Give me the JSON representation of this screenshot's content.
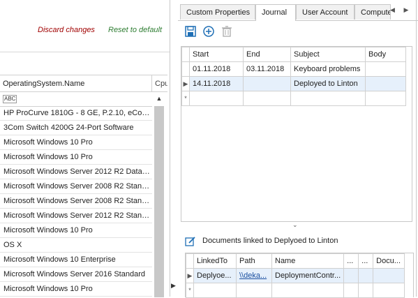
{
  "left": {
    "discard_label": "Discard changes",
    "reset_label": "Reset to default",
    "grid": {
      "col_os": "OperatingSystem.Name",
      "col_cpu": "Cpu",
      "filter_icon": "abc-filter-icon",
      "rows": [
        "HP ProCurve 1810G - 8 GE, P.2.10, eCos-2.0",
        "3Com Switch 4200G 24-Port Software",
        "Microsoft Windows 10 Pro",
        "Microsoft Windows 10 Pro",
        "Microsoft Windows Server 2012 R2 Datacenter",
        "Microsoft Windows Server 2008 R2 Standard",
        "Microsoft Windows Server 2008 R2 Standard",
        "Microsoft Windows Server 2012 R2 Standard",
        "Microsoft Windows 10 Pro",
        "OS X",
        "Microsoft Windows 10 Enterprise",
        "Microsoft Windows Server 2016 Standard",
        "Microsoft Windows 10 Pro"
      ]
    }
  },
  "tabs": [
    "Custom Properties",
    "Journal",
    "User Account",
    "Computer"
  ],
  "active_tab": "Journal",
  "journal": {
    "columns": [
      "Start",
      "End",
      "Subject",
      "Body"
    ],
    "rows": [
      {
        "start": "01.11.2018",
        "end": "03.11.2018",
        "subject": "Keyboard problems",
        "body": ""
      },
      {
        "start": "14.11.2018",
        "end": "",
        "subject": "Deployed to Linton",
        "body": ""
      }
    ],
    "new_row_marker": "*"
  },
  "documents": {
    "title": "Documents linked to Deplyoed to Linton",
    "columns": [
      "LinkedTo",
      "Path",
      "Name",
      "...",
      "...",
      "Docu..."
    ],
    "rows": [
      {
        "linked_to": "Deplyoe...",
        "path": "\\\\deka...",
        "name": "DeploymentContr..."
      }
    ],
    "new_row_marker": "*"
  },
  "colors": {
    "discard": "#a00000",
    "reset": "#2e7d32",
    "selection": "#e6f0fb",
    "accent_icon": "#1f6fb5"
  }
}
